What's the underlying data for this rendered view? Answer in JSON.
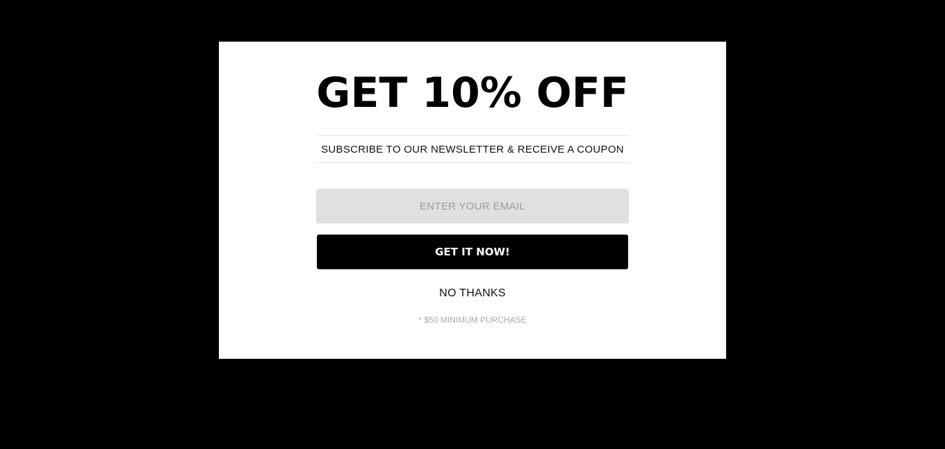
{
  "popup": {
    "headline": "GET 10% OFF",
    "subtitle": "SUBSCRIBE TO OUR NEWSLETTER & RECEIVE A COUPON",
    "email": {
      "value": "",
      "placeholder": "ENTER YOUR EMAIL"
    },
    "cta_label": "GET IT NOW!",
    "decline_label": "NO THANKS",
    "fine_print": "* $50 MINIMUM PURCHASE"
  },
  "colors": {
    "overlay": "#000000",
    "modal_background": "#ffffff",
    "input_background": "#e0e0e0",
    "button_background": "#000000",
    "button_text": "#ffffff",
    "fine_print_text": "#a9a9a9"
  }
}
